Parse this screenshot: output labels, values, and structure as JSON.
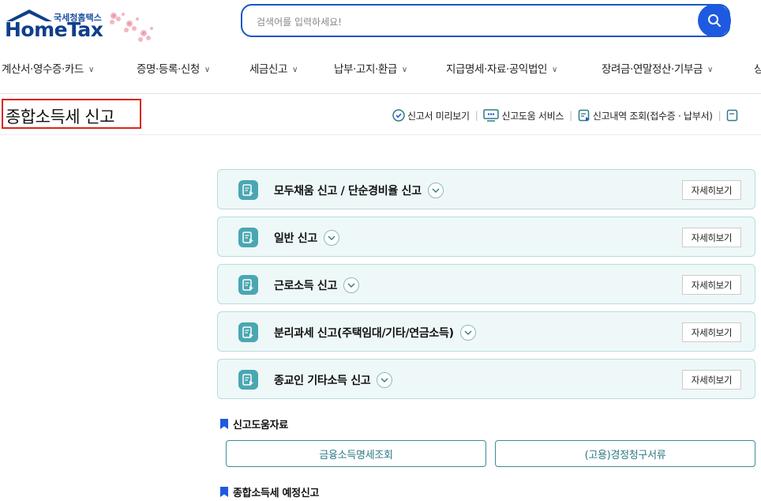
{
  "logo": {
    "subtitle": "국세청홈택스",
    "main": "HomeTax"
  },
  "search": {
    "placeholder": "검색어를 입력하세요!"
  },
  "gnb": [
    "계산서·영수증·카드",
    "증명·등록·신청",
    "세금신고",
    "납부·고지·환급",
    "지급명세·자료·공익법인",
    "장려금·연말정산·기부금",
    "상"
  ],
  "page_title": "종합소득세 신고",
  "utility_links": [
    {
      "label": "신고서 미리보기",
      "icon": "preview-icon"
    },
    {
      "label": "신고도움 서비스",
      "icon": "help-monitor-icon"
    },
    {
      "label": "신고내역 조회(접수증 · 납부서)",
      "icon": "history-icon"
    }
  ],
  "filing_options": [
    {
      "label": "모두채움 신고 / 단순경비율 신고",
      "detail": "자세히보기"
    },
    {
      "label": "일반 신고",
      "detail": "자세히보기"
    },
    {
      "label": "근로소득 신고",
      "detail": "자세히보기"
    },
    {
      "label": "분리과세 신고(주택임대/기타/연금소득)",
      "detail": "자세히보기"
    },
    {
      "label": "종교인 기타소득 신고",
      "detail": "자세히보기"
    }
  ],
  "help_section": {
    "title": "신고도움자료",
    "buttons": [
      "금융소득명세조회",
      "(고용)경정청구서류"
    ]
  },
  "forecast_section": {
    "title": "종합소득세 예정신고"
  },
  "colors": {
    "brand_blue": "#1e5ae0",
    "title_highlight": "#d9261c",
    "accent_teal": "#4aa7b2",
    "panel_bg": "#eef8f8"
  }
}
